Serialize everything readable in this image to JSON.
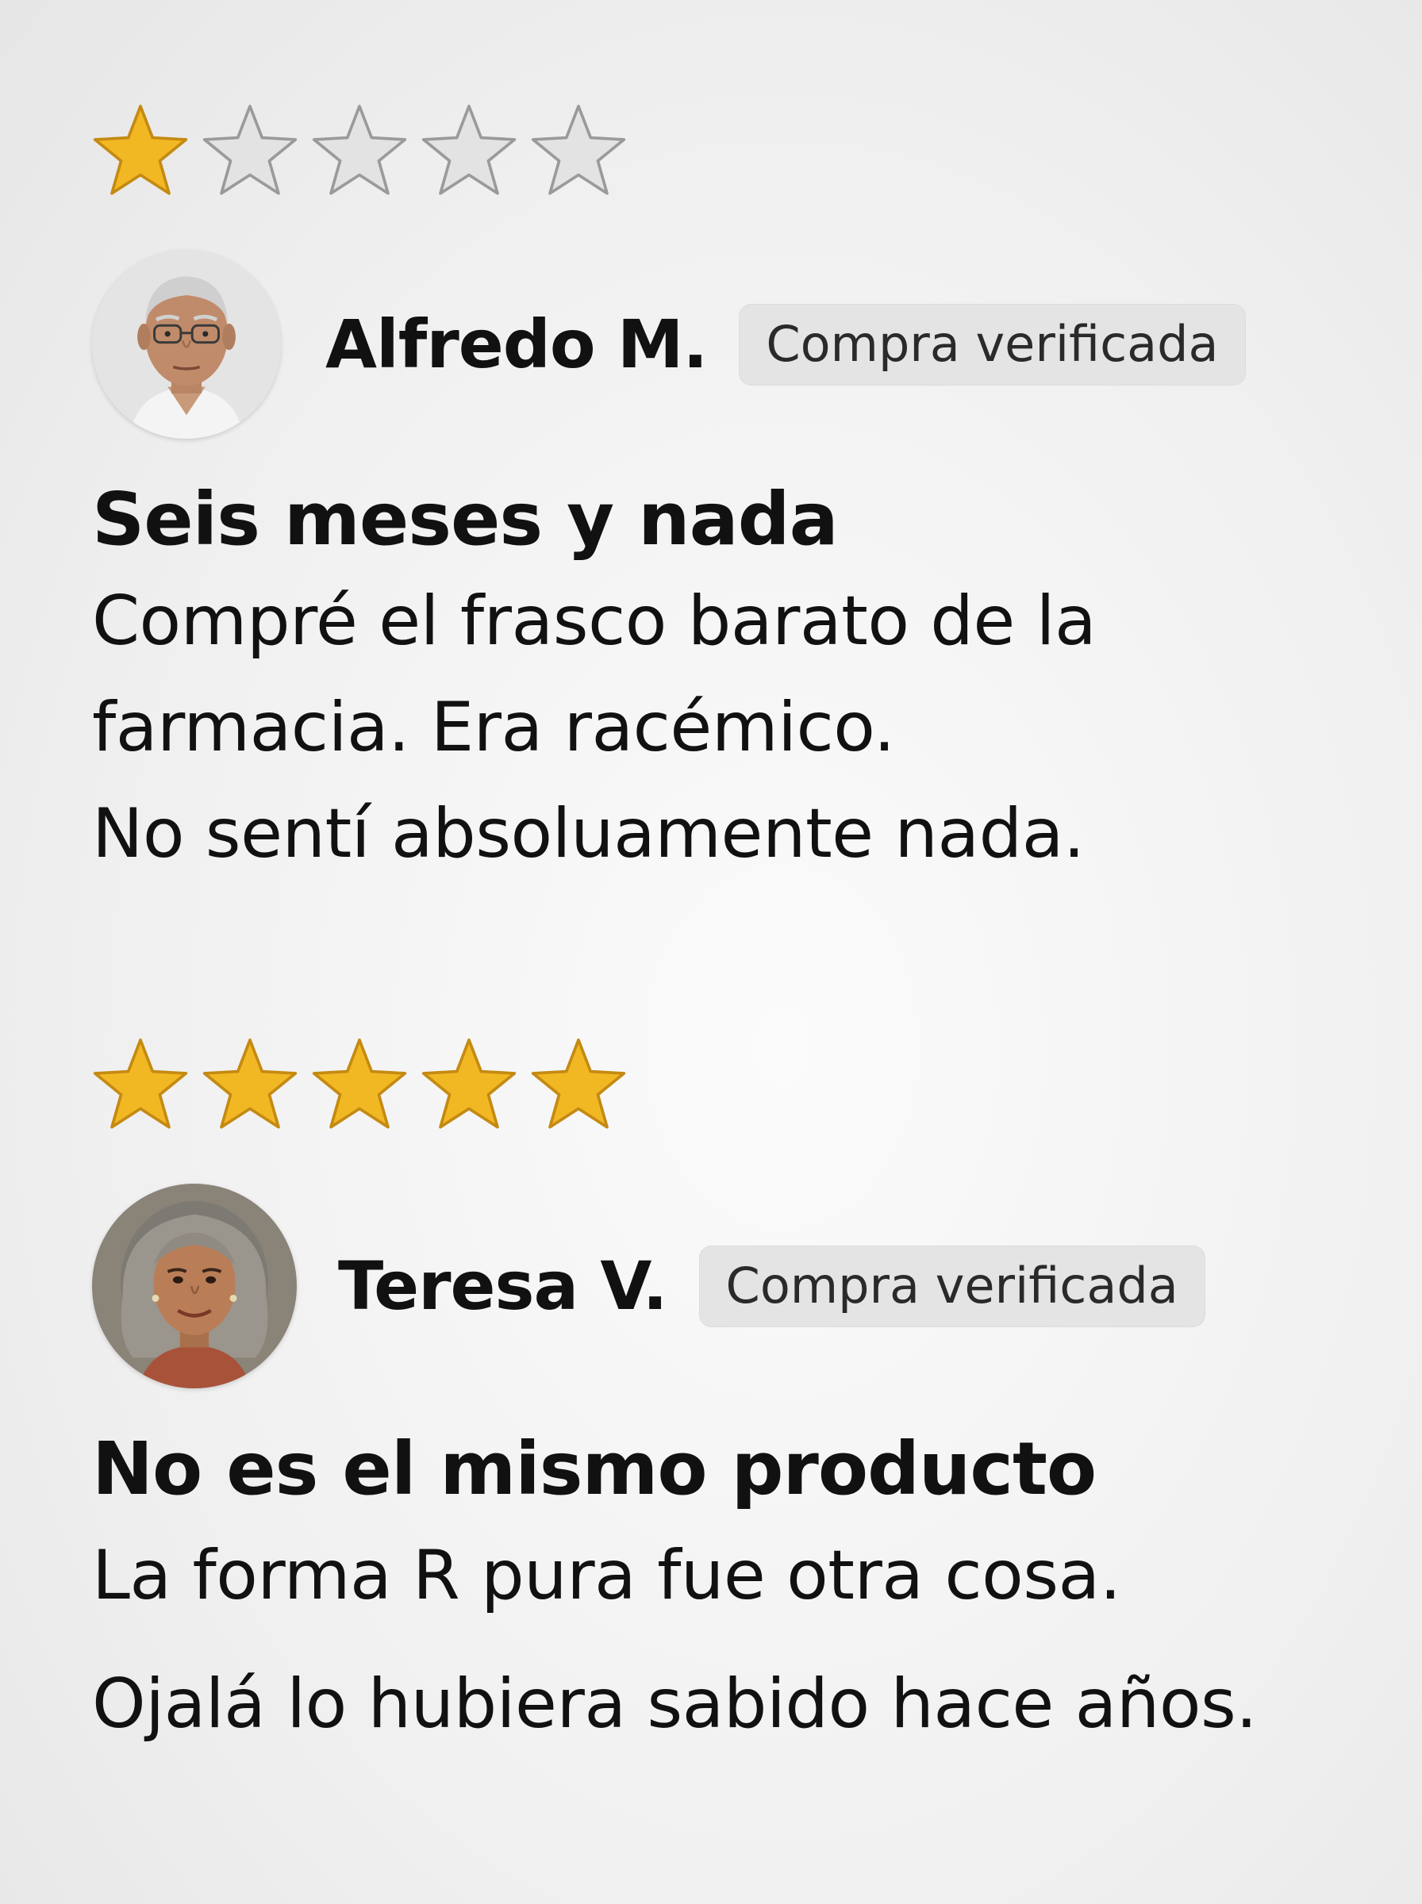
{
  "reviews": [
    {
      "rating": 1,
      "max_rating": 5,
      "reviewer_name": "Alfredo M.",
      "badge": "Compra verificada",
      "title": "Seis meses y nada",
      "body_lines": [
        "Compré el frasco barato de la",
        "farmacia. Era racémico.",
        "No sentí absoluamente nada."
      ]
    },
    {
      "rating": 5,
      "max_rating": 5,
      "reviewer_name": "Teresa V.",
      "badge": "Compra verificada",
      "title": "No es el mismo producto",
      "body_lines": [
        "La forma R pura fue otra cosa.",
        "Ojalá lo hubiera sabido hace años."
      ]
    }
  ],
  "colors": {
    "star_filled": "#f2b824",
    "star_filled_stroke": "#c48a12",
    "star_empty": "#e3e3e3",
    "star_empty_stroke": "#9a9a9a",
    "badge_bg": "#e4e4e4"
  },
  "icons": {
    "star_filled": "star-filled-icon",
    "star_empty": "star-empty-icon"
  }
}
